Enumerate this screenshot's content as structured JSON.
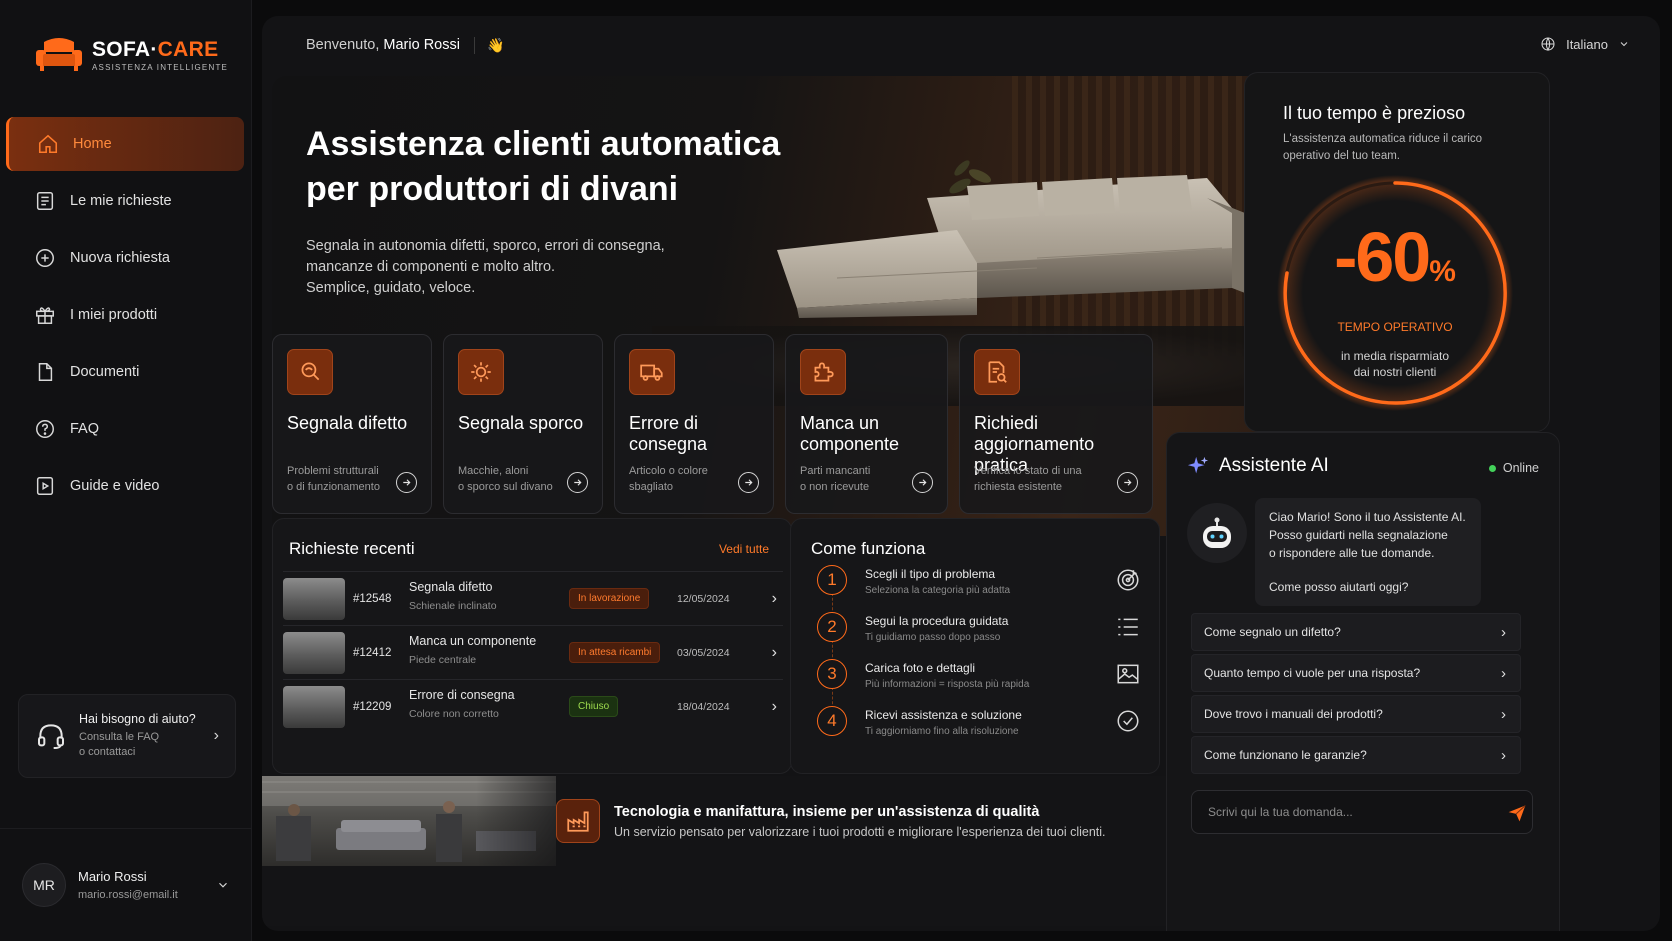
{
  "brand": {
    "name_part1": "SOFA·",
    "name_part2": "CARE",
    "tagline": "ASSISTENZA INTELLIGENTE",
    "accent": "#ff6a1a"
  },
  "sidebar": {
    "items": [
      {
        "label": "Home",
        "icon": "home-icon",
        "active": true
      },
      {
        "label": "Le mie richieste",
        "icon": "list-icon"
      },
      {
        "label": "Nuova richiesta",
        "icon": "plus-circle-icon"
      },
      {
        "label": "I miei prodotti",
        "icon": "gift-box-icon"
      },
      {
        "label": "Documenti",
        "icon": "document-icon"
      },
      {
        "label": "FAQ",
        "icon": "question-icon"
      },
      {
        "label": "Guide e video",
        "icon": "play-icon"
      }
    ],
    "help": {
      "title": "Hai bisogno di aiuto?",
      "line1": "Consulta le FAQ",
      "line2": "o contattaci"
    },
    "user": {
      "initials": "MR",
      "name": "Mario Rossi",
      "email": "mario.rossi@email.it"
    }
  },
  "header": {
    "welcome_prefix": "Benvenuto,",
    "user_name": "Mario Rossi",
    "wave": "👋",
    "language": "Italiano"
  },
  "hero": {
    "title": "Assistenza clienti automatica per produttori di divani",
    "subtitle_lines": [
      "Segnala in autonomia difetti, sporco, errori di consegna,",
      "mancanze di componenti e molto altro.",
      "Semplice, guidato, veloce."
    ]
  },
  "categories": [
    {
      "title": "Segnala difetto",
      "desc_lines": [
        "Problemi strutturali",
        "o di funzionamento"
      ],
      "icon": "magnifier-icon"
    },
    {
      "title": "Segnala sporco",
      "desc_lines": [
        "Macchie, aloni",
        "o sporco sul divano"
      ],
      "icon": "stain-icon"
    },
    {
      "title": "Errore di consegna",
      "desc_lines": [
        "Articolo o colore",
        "sbagliato"
      ],
      "icon": "truck-icon"
    },
    {
      "title": "Manca un componente",
      "desc_lines": [
        "Parti mancanti",
        "o non ricevute"
      ],
      "icon": "puzzle-icon"
    },
    {
      "title": "Richiedi aggiornamento pratica",
      "desc_lines": [
        "Verifica lo stato di una",
        "richiesta esistente"
      ],
      "icon": "document-search-icon"
    }
  ],
  "recent": {
    "title": "Richieste recenti",
    "see_all": "Vedi tutte",
    "rows": [
      {
        "id": "#12548",
        "title": "Segnala difetto",
        "sub": "Schienale inclinato",
        "status": "In lavorazione",
        "status_color": "orange",
        "date": "12/05/2024"
      },
      {
        "id": "#12412",
        "title": "Manca un componente",
        "sub": "Piede centrale",
        "status": "In attesa ricambi",
        "status_color": "orange",
        "date": "03/05/2024"
      },
      {
        "id": "#12209",
        "title": "Errore di consegna",
        "sub": "Colore non corretto",
        "status": "Chiuso",
        "status_color": "green",
        "date": "18/04/2024"
      }
    ]
  },
  "how": {
    "title": "Come funziona",
    "steps": [
      {
        "num": "1",
        "title": "Scegli il tipo di problema",
        "sub": "Seleziona la categoria più adatta",
        "icon": "target-icon"
      },
      {
        "num": "2",
        "title": "Segui la procedura guidata",
        "sub": "Ti guidiamo passo dopo passo",
        "icon": "checklist-icon"
      },
      {
        "num": "3",
        "title": "Carica foto e dettagli",
        "sub": "Più informazioni = risposta più rapida",
        "icon": "image-icon"
      },
      {
        "num": "4",
        "title": "Ricevi assistenza e soluzione",
        "sub": "Ti aggiorniamo fino alla risoluzione",
        "icon": "check-circle-icon"
      }
    ]
  },
  "banner": {
    "title": "Tecnologia e manifattura, insieme per un'assistenza di qualità",
    "subtitle": "Un servizio pensato per valorizzare i tuoi prodotti e migliorare l'esperienza dei tuoi clienti."
  },
  "stat": {
    "title": "Il tuo tempo è prezioso",
    "subtitle": "L'assistenza automatica riduce il carico operativo del tuo team.",
    "value": "-60",
    "unit": "%",
    "label": "TEMPO OPERATIVO",
    "note_line1": "in media risparmiato",
    "note_line2": "dai nostri clienti"
  },
  "assistant": {
    "title": "Assistente AI",
    "status": "Online",
    "message_lines": [
      "Ciao Mario! Sono il tuo Assistente AI.",
      "Posso guidarti nella segnalazione",
      "o rispondere alle tue domande."
    ],
    "message_question": "Come posso aiutarti oggi?",
    "faqs": [
      "Come segnalo un difetto?",
      "Quanto tempo ci vuole per una risposta?",
      "Dove trovo i manuali dei prodotti?",
      "Come funzionano le garanzie?"
    ],
    "input_placeholder": "Scrivi qui la tua domanda..."
  }
}
